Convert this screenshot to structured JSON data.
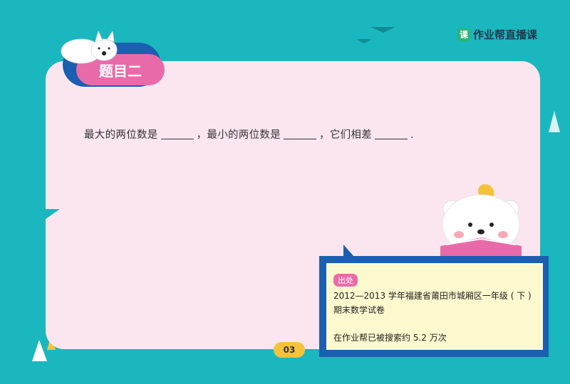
{
  "brand": {
    "icon_glyph": "课",
    "name": "作业帮直播课"
  },
  "tab": {
    "title": "题目二"
  },
  "question": {
    "part1": "最大的两位数是",
    "part2": "，最小的两位数是",
    "part3": "，它们相差",
    "end": "."
  },
  "source": {
    "badge": "出处",
    "text": "2012—2013 学年福建省莆田市城厢区一年级 ( 下 ) 期末数学试卷",
    "search_count": "在作业帮已被搜索约 5.2 万次"
  },
  "page_number": "03",
  "colors": {
    "background": "#1ab7bf",
    "card": "#fbe6f0",
    "tab": "#e96aa9",
    "frame": "#1a5fb0",
    "pager": "#f5c33b"
  }
}
